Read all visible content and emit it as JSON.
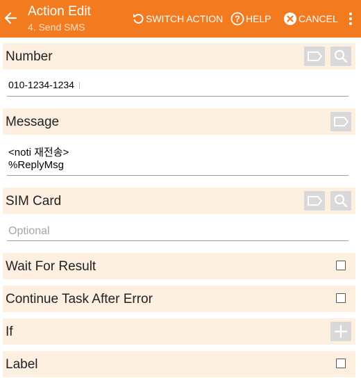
{
  "appbar": {
    "title": "Action Edit",
    "subtitle": "4. Send SMS",
    "switch_action": "SWITCH ACTION",
    "help": "HELP",
    "cancel": "CANCEL"
  },
  "number": {
    "label": "Number",
    "value": "010-1234-1234"
  },
  "message": {
    "label": "Message",
    "line1": "<noti 재전송>",
    "line2": "%ReplyMsg"
  },
  "sim_card": {
    "label": "SIM Card",
    "placeholder": "Optional"
  },
  "wait_for_result": {
    "label": "Wait For Result",
    "checked": false
  },
  "continue_task_after_error": {
    "label": "Continue Task After Error",
    "checked": false
  },
  "if": {
    "label": "If"
  },
  "label_row": {
    "label": "Label",
    "checked": false
  },
  "colors": {
    "appbar": "#f37b1f",
    "header_bg": "#fdf0e1",
    "button_bg": "#d9d9d9"
  }
}
